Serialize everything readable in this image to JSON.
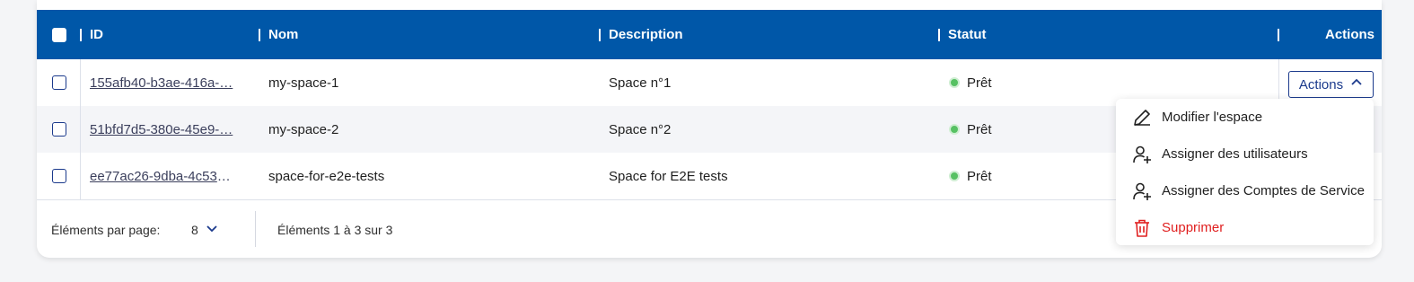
{
  "table": {
    "headers": {
      "id": "ID",
      "name": "Nom",
      "description": "Description",
      "status": "Statut",
      "actions": "Actions"
    },
    "rows": [
      {
        "id": "155afb40-b3ae-416a-…",
        "name": "my-space-1",
        "description": "Space n°1",
        "status": "Prêt"
      },
      {
        "id": "51bfd7d5-380e-45e9-…",
        "name": "my-space-2",
        "description": "Space n°2",
        "status": "Prêt"
      },
      {
        "id": "ee77ac26-9dba-4c53-…",
        "name": "space-for-e2e-tests",
        "description": "Space for E2E tests",
        "status": "Prêt"
      }
    ],
    "row_actions_button": "Actions"
  },
  "footer": {
    "per_page_label": "Éléments par page:",
    "per_page_value": "8",
    "range_text": "Éléments 1 à 3 sur 3"
  },
  "actions_menu": {
    "items": [
      {
        "label": "Modifier l'espace",
        "icon": "pencil-icon"
      },
      {
        "label": "Assigner des utilisateurs",
        "icon": "user-plus-icon"
      },
      {
        "label": "Assigner des Comptes de Service",
        "icon": "user-plus-icon"
      },
      {
        "label": "Supprimer",
        "icon": "trash-icon"
      }
    ]
  },
  "colors": {
    "header_bg": "#0057a8",
    "status_ready": "#57c163",
    "danger": "#e02020",
    "link": "#3b3f5c"
  }
}
